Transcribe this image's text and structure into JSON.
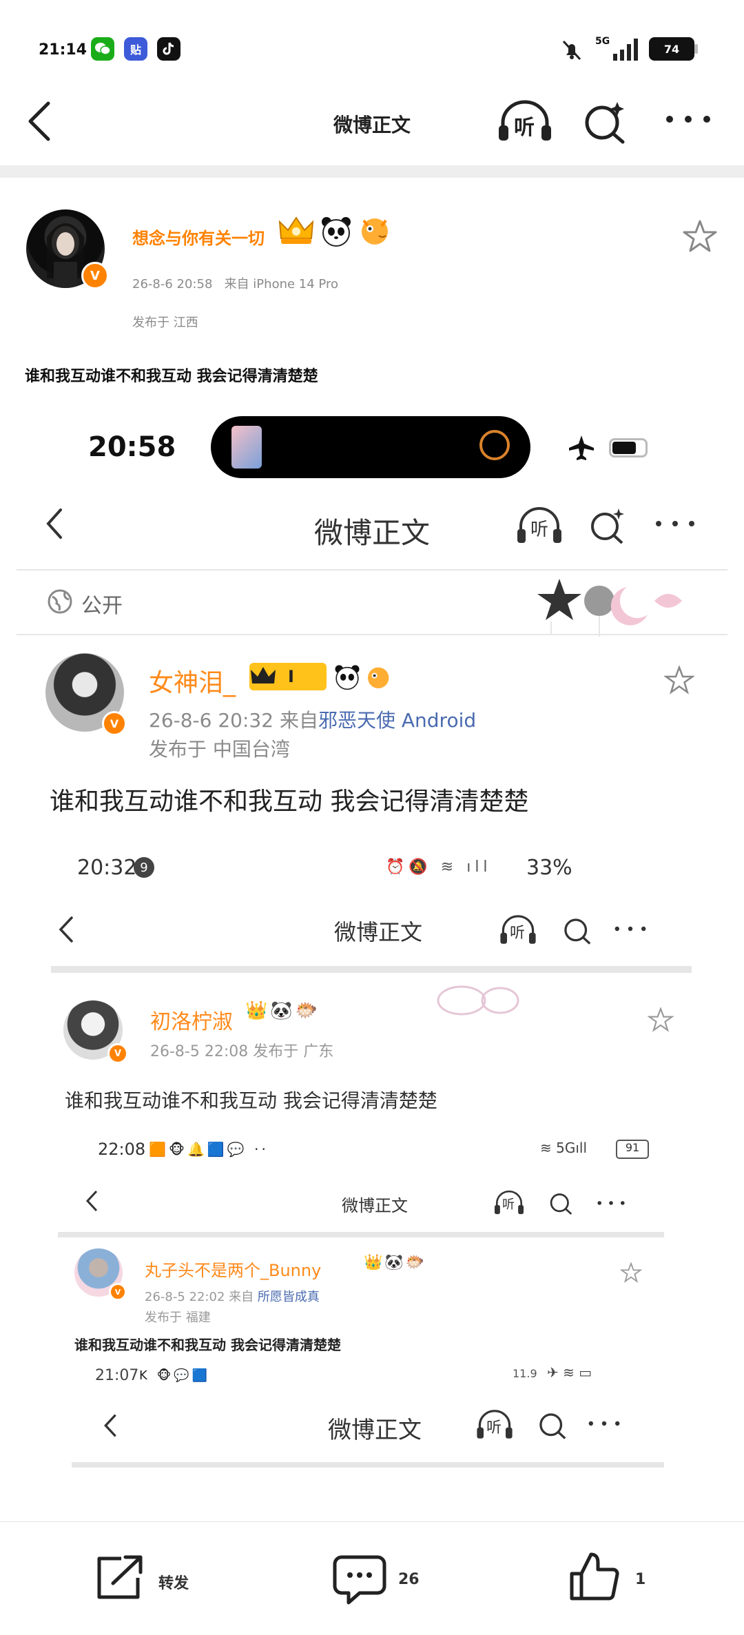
{
  "status": {
    "time": "21:14",
    "network": "5G",
    "battery": "74",
    "apps": [
      "wechat-icon",
      "tieba-icon",
      "tiktok-icon"
    ]
  },
  "nav": {
    "title": "微博正文",
    "listen_icon": "听"
  },
  "post": {
    "username": "想念与你有关一切",
    "time": "26-8-6 20:58",
    "source": "来自 iPhone 14 Pro",
    "location": "发布于 江西",
    "text": "谁和我互动谁不和我互动 我会记得清清楚楚"
  },
  "shot1": {
    "time": "20:58",
    "nav_title": "微博正文",
    "listen_icon": "听",
    "visibility": "公开",
    "username": "女神泪_",
    "level": "I",
    "time_source_prefix": "26-8-6 20:32  来自",
    "source_link": "邪恶天使 Android",
    "location": "发布于 中国台湾",
    "text": "谁和我互动谁不和我互动 我会记得清清楚楚"
  },
  "shot2": {
    "time": "20:32",
    "notif_count": "9",
    "battery": "33%",
    "nav_title": "微博正文",
    "listen_icon": "听",
    "username": "初洛柠淑",
    "meta": "26-8-5 22:08  发布于 广东",
    "text": "谁和我互动谁不和我互动 我会记得清清楚楚"
  },
  "shot3": {
    "time": "22:08",
    "network": "5G",
    "battery": "91",
    "nav_title": "微博正文",
    "listen_icon": "听",
    "username": "丸子头不是两个_Bunny",
    "time_source_prefix": "26-8-5 22:02  来自",
    "source_link": "所愿皆成真",
    "location": "发布于 福建",
    "text": "谁和我互动谁不和我互动 我会记得清清楚楚"
  },
  "shot4": {
    "time": "21:07",
    "speed": "11.9",
    "nav_title": "微博正文",
    "listen_icon": "听"
  },
  "bottom": {
    "repost": "转发",
    "comments": "26",
    "likes": "1"
  },
  "colors": {
    "accent": "#ff8200",
    "link": "#4a6bb0"
  }
}
